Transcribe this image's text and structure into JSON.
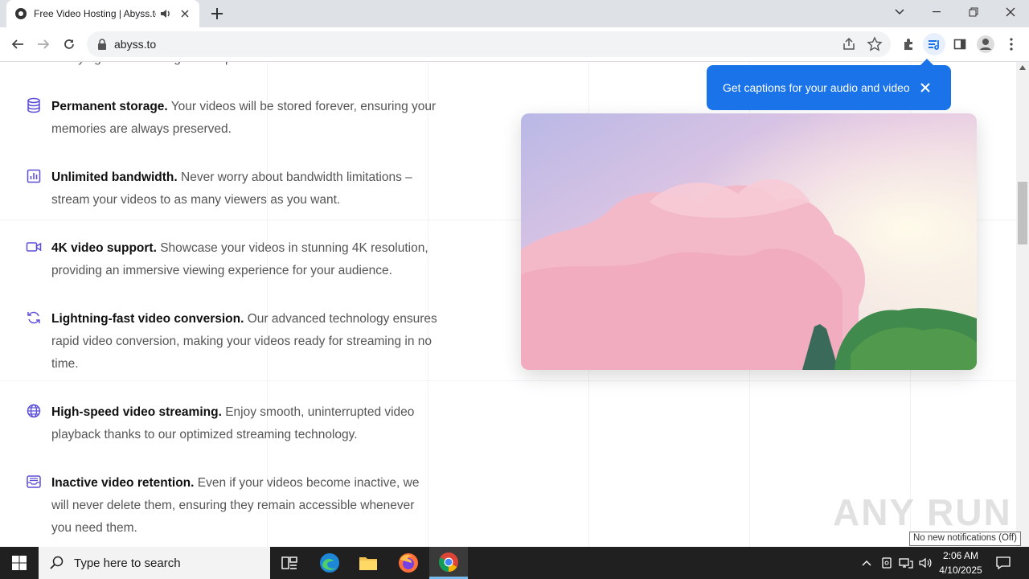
{
  "browser": {
    "tab_title": "Free Video Hosting | Abyss.to",
    "url": "abyss.to"
  },
  "features": [
    {
      "title": "",
      "text": "Worrying about running out of space.",
      "icon": "partial-icon"
    },
    {
      "title": "Permanent storage.",
      "text": " Your videos will be stored forever, ensuring your memories are always preserved.",
      "icon": "database-icon"
    },
    {
      "title": "Unlimited bandwidth.",
      "text": " Never worry about bandwidth limitations – stream your videos to as many viewers as you want.",
      "icon": "bar-chart-icon"
    },
    {
      "title": "4K video support.",
      "text": " Showcase your videos in stunning 4K resolution, providing an immersive viewing experience for your audience.",
      "icon": "video-camera-icon"
    },
    {
      "title": "Lightning-fast video conversion.",
      "text": " Our advanced technology ensures rapid video conversion, making your videos ready for streaming in no time.",
      "icon": "refresh-icon"
    },
    {
      "title": "High-speed video streaming.",
      "text": " Enjoy smooth, uninterrupted video playback thanks to our optimized streaming technology.",
      "icon": "globe-icon"
    },
    {
      "title": "Inactive video retention.",
      "text": " Even if your videos become inactive, we will never delete them, ensuring they remain accessible whenever you need them.",
      "icon": "inbox-icon"
    }
  ],
  "tooltip": {
    "text": "Get captions for your audio and video"
  },
  "watermark": "ANY RUN",
  "notification": "No new notifications (Off)",
  "taskbar": {
    "search_placeholder": "Type here to search",
    "time": "2:06 AM",
    "date": "4/10/2025"
  },
  "colors": {
    "accent": "#1a73e8",
    "feature_icon": "#5b4fd9",
    "taskbar": "#202020"
  }
}
